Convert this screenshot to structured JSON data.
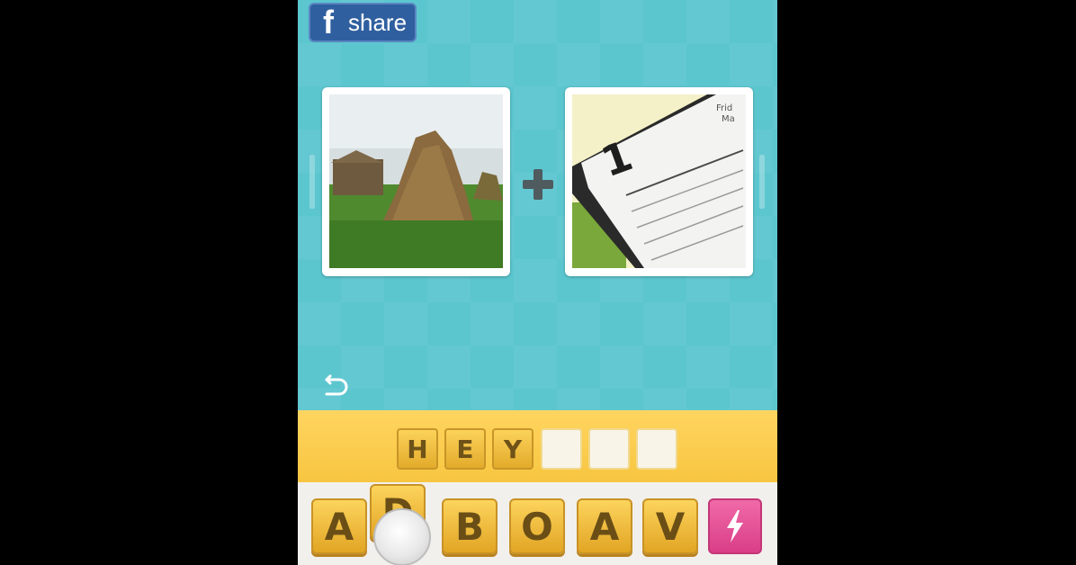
{
  "share": {
    "icon": "facebook-icon",
    "icon_glyph": "f",
    "label": "share",
    "color": "#2f5f9f"
  },
  "clues": [
    {
      "name": "clue-image-haystack",
      "description_icon": "haystack-photo-icon"
    },
    {
      "name": "clue-image-calendar",
      "description_icon": "calendar-page-photo-icon",
      "calendar_day": "1",
      "calendar_header_1": "Frid",
      "calendar_header_2": "Ma"
    }
  ],
  "plus_icon": "plus-icon",
  "undo_icon": "undo-icon",
  "answer": {
    "letters": [
      "H",
      "E",
      "Y",
      "",
      "",
      ""
    ]
  },
  "letter_tiles": [
    "A",
    "D",
    "B",
    "O",
    "A",
    "V"
  ],
  "power_button": {
    "icon": "lightning-icon",
    "color": "#e04c92"
  },
  "colors": {
    "background": "#5cc6cf",
    "answer_bar": "#f7c540",
    "tile": "#f2c140"
  }
}
